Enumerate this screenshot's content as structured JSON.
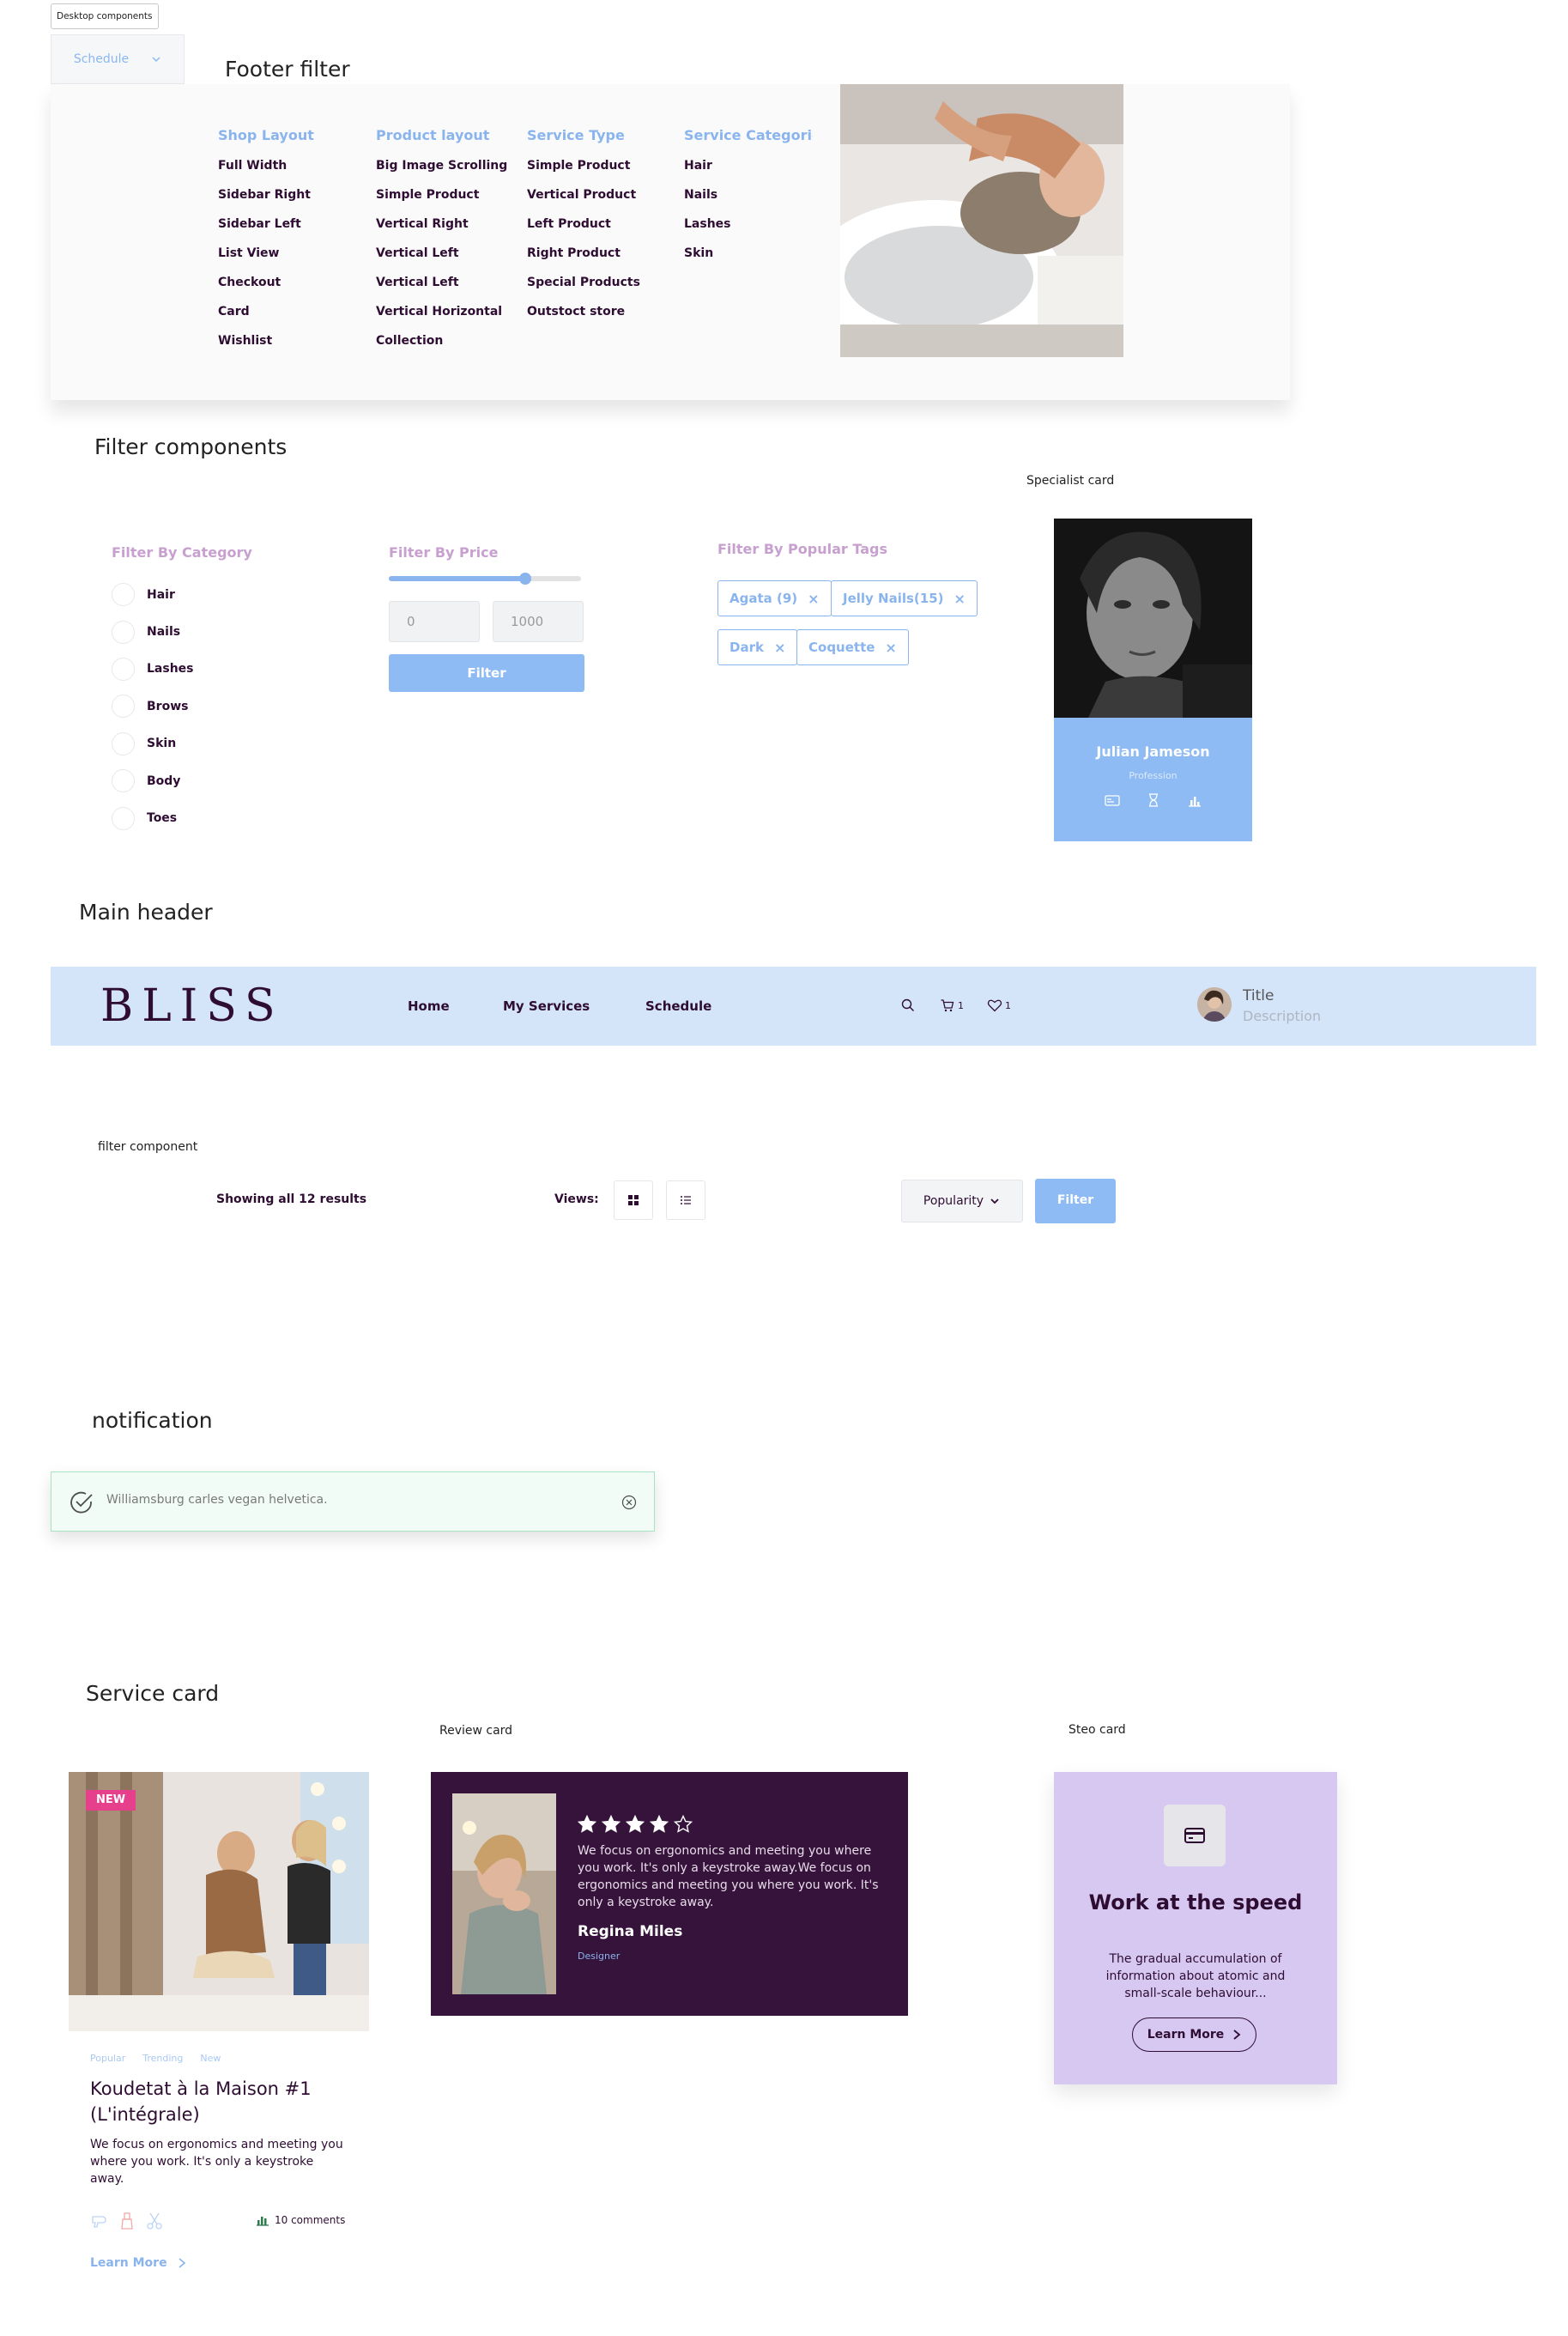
{
  "top": {
    "badge": "Desktop components",
    "schedule_dropdown": "Schedule"
  },
  "sections": {
    "footer_filter": "Footer filter",
    "filter_components": "Filter components",
    "specialist_card": "Specialist card",
    "main_header": "Main header",
    "filter_component": "filter component",
    "notification": "notification",
    "service_card": "Service card",
    "review_card": "Review card",
    "step_card": "Steo card"
  },
  "mega_menu": {
    "columns": [
      {
        "title": "Shop Layout",
        "items": [
          "Full Width",
          "Sidebar Right",
          "Sidebar Left",
          "List View",
          "Checkout",
          "Card",
          "Wishlist"
        ]
      },
      {
        "title": "Product layout",
        "items": [
          "Big Image Scrolling",
          "Simple Product",
          "Vertical Right",
          "Vertical Left",
          "Vertical Left",
          "Vertical Horizontal",
          "Collection"
        ]
      },
      {
        "title": "Service Type",
        "items": [
          "Simple Product",
          "Vertical Product",
          "Left Product",
          "Right Product",
          "Special Products",
          "Outstoct store"
        ]
      },
      {
        "title": "Service Categories",
        "items": [
          "Hair",
          "Nails",
          "Lashes",
          "Skin"
        ]
      }
    ]
  },
  "filters": {
    "category": {
      "title": "Filter By Category",
      "items": [
        "Hair",
        "Nails",
        "Lashes",
        "Brows",
        "Skin",
        "Body",
        "Toes"
      ]
    },
    "price": {
      "title": "Filter By Price",
      "min": "0",
      "max": "1000",
      "slider_fraction": 0.71,
      "button": "Filter"
    },
    "tags": {
      "title": "Filter By Popular Tags",
      "items": [
        "Agata (9)",
        "Jelly Nails(15)",
        "Dark",
        "Coquette"
      ]
    }
  },
  "specialist": {
    "name": "Julian Jameson",
    "profession": "Profession",
    "icons": [
      "id-card-icon",
      "hourglass-icon",
      "chart-icon"
    ]
  },
  "header": {
    "logo": "BLISS",
    "nav": [
      "Home",
      "My Services",
      "Schedule"
    ],
    "cart_count": "1",
    "wishlist_count": "1",
    "profile_title": "Title",
    "profile_description": "Description"
  },
  "results_bar": {
    "results": "Showing all 12 results",
    "views_label": "Views:",
    "sort": "Popularity",
    "button": "Filter"
  },
  "notification": {
    "text": "Williamsburg carles vegan helvetica."
  },
  "service_card": {
    "badge": "NEW",
    "tags": [
      "Popular",
      "Trending",
      "New"
    ],
    "title": "Koudetat à la Maison #1 (L'intégrale)",
    "description": "We focus on ergonomics and meeting you where you work. It's only a keystroke away.",
    "comments": "10 comments",
    "learn_more": "Learn More"
  },
  "review_card": {
    "rating": 4,
    "max_rating": 5,
    "text": "We focus on ergonomics and meeting you where you work. It's only a keystroke away.We focus on ergonomics and meeting you where you work. It's only a keystroke away.",
    "name": "Regina Miles",
    "role": "Designer"
  },
  "step_card": {
    "title": "Work at the speed",
    "description": "The gradual accumulation of information about atomic and small-scale behaviour...",
    "button": "Learn More"
  },
  "colors": {
    "accent_blue": "#8ebbf3",
    "dark_purple": "#2f0d33",
    "review_bg": "#35133a",
    "step_bg": "#d6c8f0",
    "header_bg": "#d4e4f9",
    "new_badge": "#e63f8c",
    "category_heading": "#c7a0cf"
  }
}
